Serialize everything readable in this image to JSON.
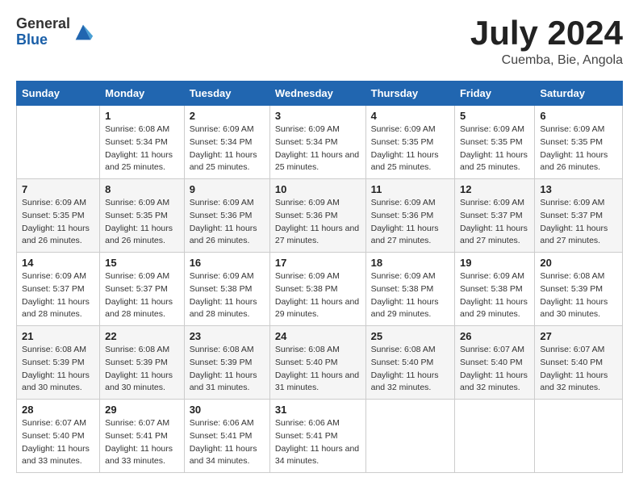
{
  "header": {
    "logo_line1": "General",
    "logo_line2": "Blue",
    "month_title": "July 2024",
    "location": "Cuemba, Bie, Angola"
  },
  "days_of_week": [
    "Sunday",
    "Monday",
    "Tuesday",
    "Wednesday",
    "Thursday",
    "Friday",
    "Saturday"
  ],
  "weeks": [
    [
      {
        "day": "",
        "sunrise": "",
        "sunset": "",
        "daylight": ""
      },
      {
        "day": "1",
        "sunrise": "6:08 AM",
        "sunset": "5:34 PM",
        "daylight": "11 hours and 25 minutes."
      },
      {
        "day": "2",
        "sunrise": "6:09 AM",
        "sunset": "5:34 PM",
        "daylight": "11 hours and 25 minutes."
      },
      {
        "day": "3",
        "sunrise": "6:09 AM",
        "sunset": "5:34 PM",
        "daylight": "11 hours and 25 minutes."
      },
      {
        "day": "4",
        "sunrise": "6:09 AM",
        "sunset": "5:35 PM",
        "daylight": "11 hours and 25 minutes."
      },
      {
        "day": "5",
        "sunrise": "6:09 AM",
        "sunset": "5:35 PM",
        "daylight": "11 hours and 25 minutes."
      },
      {
        "day": "6",
        "sunrise": "6:09 AM",
        "sunset": "5:35 PM",
        "daylight": "11 hours and 26 minutes."
      }
    ],
    [
      {
        "day": "7",
        "sunrise": "6:09 AM",
        "sunset": "5:35 PM",
        "daylight": "11 hours and 26 minutes."
      },
      {
        "day": "8",
        "sunrise": "6:09 AM",
        "sunset": "5:35 PM",
        "daylight": "11 hours and 26 minutes."
      },
      {
        "day": "9",
        "sunrise": "6:09 AM",
        "sunset": "5:36 PM",
        "daylight": "11 hours and 26 minutes."
      },
      {
        "day": "10",
        "sunrise": "6:09 AM",
        "sunset": "5:36 PM",
        "daylight": "11 hours and 27 minutes."
      },
      {
        "day": "11",
        "sunrise": "6:09 AM",
        "sunset": "5:36 PM",
        "daylight": "11 hours and 27 minutes."
      },
      {
        "day": "12",
        "sunrise": "6:09 AM",
        "sunset": "5:37 PM",
        "daylight": "11 hours and 27 minutes."
      },
      {
        "day": "13",
        "sunrise": "6:09 AM",
        "sunset": "5:37 PM",
        "daylight": "11 hours and 27 minutes."
      }
    ],
    [
      {
        "day": "14",
        "sunrise": "6:09 AM",
        "sunset": "5:37 PM",
        "daylight": "11 hours and 28 minutes."
      },
      {
        "day": "15",
        "sunrise": "6:09 AM",
        "sunset": "5:37 PM",
        "daylight": "11 hours and 28 minutes."
      },
      {
        "day": "16",
        "sunrise": "6:09 AM",
        "sunset": "5:38 PM",
        "daylight": "11 hours and 28 minutes."
      },
      {
        "day": "17",
        "sunrise": "6:09 AM",
        "sunset": "5:38 PM",
        "daylight": "11 hours and 29 minutes."
      },
      {
        "day": "18",
        "sunrise": "6:09 AM",
        "sunset": "5:38 PM",
        "daylight": "11 hours and 29 minutes."
      },
      {
        "day": "19",
        "sunrise": "6:09 AM",
        "sunset": "5:38 PM",
        "daylight": "11 hours and 29 minutes."
      },
      {
        "day": "20",
        "sunrise": "6:08 AM",
        "sunset": "5:39 PM",
        "daylight": "11 hours and 30 minutes."
      }
    ],
    [
      {
        "day": "21",
        "sunrise": "6:08 AM",
        "sunset": "5:39 PM",
        "daylight": "11 hours and 30 minutes."
      },
      {
        "day": "22",
        "sunrise": "6:08 AM",
        "sunset": "5:39 PM",
        "daylight": "11 hours and 30 minutes."
      },
      {
        "day": "23",
        "sunrise": "6:08 AM",
        "sunset": "5:39 PM",
        "daylight": "11 hours and 31 minutes."
      },
      {
        "day": "24",
        "sunrise": "6:08 AM",
        "sunset": "5:40 PM",
        "daylight": "11 hours and 31 minutes."
      },
      {
        "day": "25",
        "sunrise": "6:08 AM",
        "sunset": "5:40 PM",
        "daylight": "11 hours and 32 minutes."
      },
      {
        "day": "26",
        "sunrise": "6:07 AM",
        "sunset": "5:40 PM",
        "daylight": "11 hours and 32 minutes."
      },
      {
        "day": "27",
        "sunrise": "6:07 AM",
        "sunset": "5:40 PM",
        "daylight": "11 hours and 32 minutes."
      }
    ],
    [
      {
        "day": "28",
        "sunrise": "6:07 AM",
        "sunset": "5:40 PM",
        "daylight": "11 hours and 33 minutes."
      },
      {
        "day": "29",
        "sunrise": "6:07 AM",
        "sunset": "5:41 PM",
        "daylight": "11 hours and 33 minutes."
      },
      {
        "day": "30",
        "sunrise": "6:06 AM",
        "sunset": "5:41 PM",
        "daylight": "11 hours and 34 minutes."
      },
      {
        "day": "31",
        "sunrise": "6:06 AM",
        "sunset": "5:41 PM",
        "daylight": "11 hours and 34 minutes."
      },
      {
        "day": "",
        "sunrise": "",
        "sunset": "",
        "daylight": ""
      },
      {
        "day": "",
        "sunrise": "",
        "sunset": "",
        "daylight": ""
      },
      {
        "day": "",
        "sunrise": "",
        "sunset": "",
        "daylight": ""
      }
    ]
  ],
  "labels": {
    "sunrise_prefix": "Sunrise: ",
    "sunset_prefix": "Sunset: ",
    "daylight_prefix": "Daylight: "
  }
}
